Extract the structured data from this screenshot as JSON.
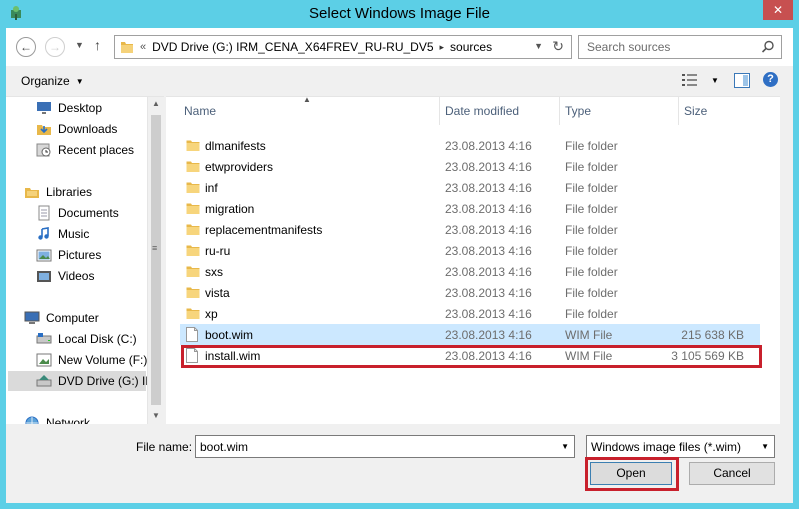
{
  "window": {
    "title": "Select Windows Image File",
    "close_glyph": "✕"
  },
  "nav": {
    "back_glyph": "←",
    "forward_glyph": "→",
    "recent_glyph": "▼",
    "up_glyph": "↑"
  },
  "address": {
    "overflow_glyph": "«",
    "crumbs": [
      "DVD Drive (G:) IRM_CENA_X64FREV_RU-RU_DV5",
      "sources"
    ],
    "separator_glyph": "▸",
    "dropdown_glyph": "▼",
    "refresh_glyph": "↻"
  },
  "search": {
    "placeholder": "Search sources"
  },
  "toolbar": {
    "organize_label": "Organize",
    "organize_caret": "▼",
    "views_caret": "▼",
    "help_glyph": "?"
  },
  "navpane": {
    "items": [
      {
        "label": "Desktop",
        "icon": "desktop-icon"
      },
      {
        "label": "Downloads",
        "icon": "downloads-icon"
      },
      {
        "label": "Recent places",
        "icon": "recent-places-icon"
      },
      {
        "label": "Libraries",
        "icon": "libraries-icon"
      },
      {
        "label": "Documents",
        "icon": "documents-icon"
      },
      {
        "label": "Music",
        "icon": "music-icon"
      },
      {
        "label": "Pictures",
        "icon": "pictures-icon"
      },
      {
        "label": "Videos",
        "icon": "videos-icon"
      },
      {
        "label": "Computer",
        "icon": "computer-icon"
      },
      {
        "label": "Local Disk (C:)",
        "icon": "local-disk-icon"
      },
      {
        "label": "New Volume (F:)",
        "icon": "new-volume-icon"
      },
      {
        "label": "DVD Drive (G:) IR",
        "icon": "dvd-drive-icon"
      },
      {
        "label": "Network",
        "icon": "network-icon"
      }
    ],
    "scroll_up_glyph": "▲",
    "scroll_down_glyph": "▼",
    "grip_glyph": "≡"
  },
  "columns": {
    "name": "Name",
    "date": "Date modified",
    "type": "Type",
    "size": "Size",
    "sort_glyph": "▲"
  },
  "files": [
    {
      "name": "dlmanifests",
      "date": "23.08.2013 4:16",
      "type": "File folder",
      "size": "",
      "icon": "folder-icon"
    },
    {
      "name": "etwproviders",
      "date": "23.08.2013 4:16",
      "type": "File folder",
      "size": "",
      "icon": "folder-icon"
    },
    {
      "name": "inf",
      "date": "23.08.2013 4:16",
      "type": "File folder",
      "size": "",
      "icon": "folder-icon"
    },
    {
      "name": "migration",
      "date": "23.08.2013 4:16",
      "type": "File folder",
      "size": "",
      "icon": "folder-icon"
    },
    {
      "name": "replacementmanifests",
      "date": "23.08.2013 4:16",
      "type": "File folder",
      "size": "",
      "icon": "folder-icon"
    },
    {
      "name": "ru-ru",
      "date": "23.08.2013 4:16",
      "type": "File folder",
      "size": "",
      "icon": "folder-icon"
    },
    {
      "name": "sxs",
      "date": "23.08.2013 4:16",
      "type": "File folder",
      "size": "",
      "icon": "folder-icon"
    },
    {
      "name": "vista",
      "date": "23.08.2013 4:16",
      "type": "File folder",
      "size": "",
      "icon": "folder-icon"
    },
    {
      "name": "xp",
      "date": "23.08.2013 4:16",
      "type": "File folder",
      "size": "",
      "icon": "folder-icon"
    },
    {
      "name": "boot.wim",
      "date": "23.08.2013 4:16",
      "type": "WIM File",
      "size": "215 638 KB",
      "icon": "file-icon",
      "selected": true
    },
    {
      "name": "install.wim",
      "date": "23.08.2013 4:16",
      "type": "WIM File",
      "size": "3 105 569 KB",
      "icon": "file-icon"
    }
  ],
  "bottom": {
    "file_name_label": "File name:",
    "file_name_value": "boot.wim",
    "file_name_dd": "▼",
    "filter_value": "Windows image files (*.wim)",
    "filter_dd": "▼",
    "open_label": "Open",
    "cancel_label": "Cancel"
  },
  "colors": {
    "frame": "#5ccfe6",
    "selection": "#cce8ff",
    "highlight": "#c8202c",
    "close": "#c75050"
  }
}
